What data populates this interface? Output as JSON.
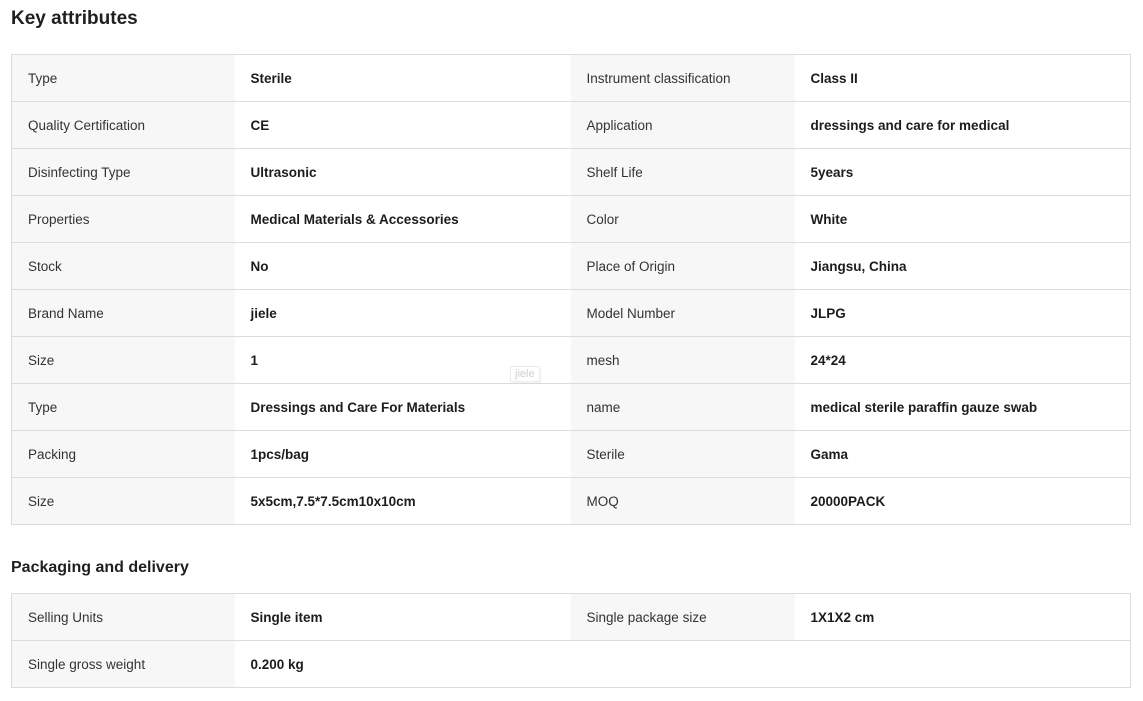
{
  "key_attributes": {
    "title": "Key attributes",
    "rows": [
      {
        "k1": "Type",
        "v1": "Sterile",
        "k2": "Instrument classification",
        "v2": "Class II"
      },
      {
        "k1": "Quality Certification",
        "v1": "CE",
        "k2": "Application",
        "v2": "dressings and care for medical"
      },
      {
        "k1": "Disinfecting Type",
        "v1": "Ultrasonic",
        "k2": "Shelf Life",
        "v2": "5years"
      },
      {
        "k1": "Properties",
        "v1": "Medical Materials & Accessories",
        "k2": "Color",
        "v2": "White"
      },
      {
        "k1": "Stock",
        "v1": "No",
        "k2": "Place of Origin",
        "v2": "Jiangsu, China"
      },
      {
        "k1": "Brand Name",
        "v1": "jiele",
        "k2": "Model Number",
        "v2": "JLPG"
      },
      {
        "k1": "Size",
        "v1": "1",
        "k2": "mesh",
        "v2": "24*24"
      },
      {
        "k1": "Type",
        "v1": "Dressings and Care For Materials",
        "k2": "name",
        "v2": "medical sterile paraffin gauze swab"
      },
      {
        "k1": "Packing",
        "v1": "1pcs/bag",
        "k2": "Sterile",
        "v2": "Gama"
      },
      {
        "k1": "Size",
        "v1": "5x5cm,7.5*7.5cm10x10cm",
        "k2": "MOQ",
        "v2": "20000PACK"
      }
    ]
  },
  "watermark": {
    "text": "jiele"
  },
  "packaging": {
    "title": "Packaging and delivery",
    "rows": [
      {
        "k1": "Selling Units",
        "v1": "Single item",
        "k2": "Single package size",
        "v2": "1X1X2 cm"
      },
      {
        "k1": "Single gross weight",
        "v1": "0.200 kg"
      }
    ]
  }
}
